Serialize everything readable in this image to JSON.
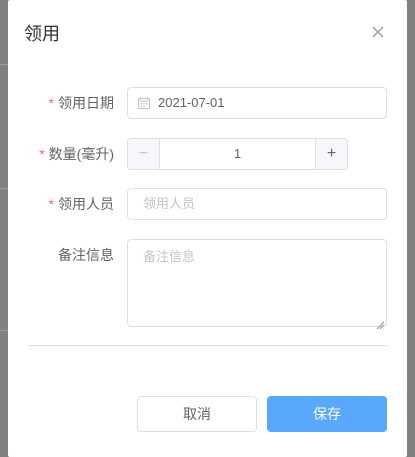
{
  "dialog": {
    "title": "领用",
    "close_icon": "close-icon"
  },
  "form": {
    "date": {
      "label": "领用日期",
      "required": "*",
      "value": "2021-07-01",
      "icon": "calendar-icon"
    },
    "quantity": {
      "label": "数量(毫升)",
      "required": "*",
      "value": "1",
      "minus": "−",
      "plus": "+"
    },
    "person": {
      "label": "领用人员",
      "required": "*",
      "placeholder": "领用人员"
    },
    "remarks": {
      "label": "备注信息",
      "placeholder": "备注信息"
    }
  },
  "footer": {
    "cancel_label": "取消",
    "save_label": "保存"
  },
  "colors": {
    "primary": "#5aa8fb",
    "required": "#f56c6c",
    "border": "#dcdfe6",
    "overlay": "#808080"
  }
}
